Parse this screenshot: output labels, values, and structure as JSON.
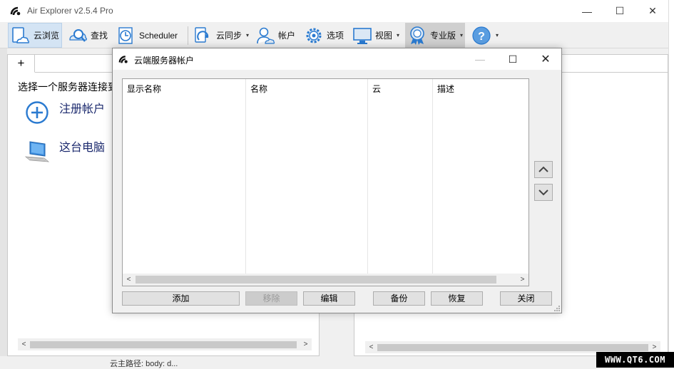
{
  "app": {
    "title": "Air Explorer v2.5.4 Pro"
  },
  "window_controls": {
    "minimize": "—",
    "maximize": "☐",
    "close": "✕"
  },
  "toolbar": {
    "cloud_browse": "云浏览",
    "search": "查找",
    "scheduler": "Scheduler",
    "sync": "云同步",
    "accounts": "帐户",
    "options": "选项",
    "view": "视图",
    "pro": "专业版",
    "caret": "▾"
  },
  "left_pane": {
    "add_tab": "+",
    "select_label": "选择一个服务器连接到",
    "items": [
      {
        "label": "注册帐户",
        "icon": "add-circle-icon"
      },
      {
        "label": "这台电脑",
        "icon": "computer-icon"
      }
    ]
  },
  "status": {
    "text": "云主路径: body: d..."
  },
  "dialog": {
    "title": "云端服务器帐户",
    "columns": [
      "显示名称",
      "名称",
      "云",
      "描述"
    ],
    "buttons": {
      "add": "添加",
      "remove": "移除",
      "edit": "编辑",
      "backup": "备份",
      "restore": "恢复",
      "close": "关闭"
    }
  },
  "scroll": {
    "left": "<",
    "right": ">"
  },
  "watermark": "WWW.QT6.COM",
  "colors": {
    "accent": "#1a73c8",
    "link_text": "#1c2a6e",
    "active_tool_bg": "#d4e4f4"
  }
}
